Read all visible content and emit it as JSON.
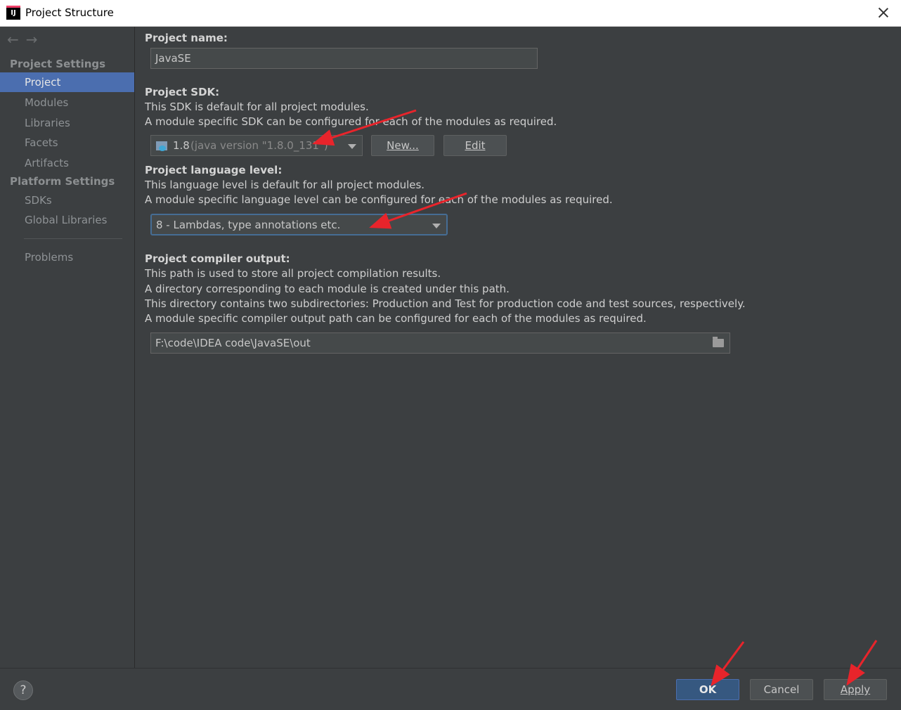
{
  "window": {
    "title": "Project Structure",
    "app_icon_text": "IJ"
  },
  "sidebar": {
    "section_project_settings": "Project Settings",
    "section_platform_settings": "Platform Settings",
    "items": [
      "Project",
      "Modules",
      "Libraries",
      "Facets",
      "Artifacts"
    ],
    "platform_items": [
      "SDKs",
      "Global Libraries"
    ],
    "problems": "Problems",
    "selected": "Project"
  },
  "main": {
    "project_name_label": "Project name:",
    "project_name_value": "JavaSE",
    "sdk_label": "Project SDK:",
    "sdk_desc1": "This SDK is default for all project modules.",
    "sdk_desc2": "A module specific SDK can be configured for each of the modules as required.",
    "sdk_value": "1.8",
    "sdk_version": "(java version \"1.8.0_131\")",
    "sdk_new_button": "New...",
    "sdk_edit_button": "Edit",
    "lang_label": "Project language level:",
    "lang_desc1": "This language level is default for all project modules.",
    "lang_desc2": "A module specific language level can be configured for each of the modules as required.",
    "lang_value": "8 - Lambdas, type annotations etc.",
    "output_label": "Project compiler output:",
    "output_desc1": "This path is used to store all project compilation results.",
    "output_desc2": "A directory corresponding to each module is created under this path.",
    "output_desc3": "This directory contains two subdirectories: Production and Test for production code and test sources, respectively.",
    "output_desc4": "A module specific compiler output path can be configured for each of the modules as required.",
    "output_value": "F:\\code\\IDEA code\\JavaSE\\out"
  },
  "footer": {
    "help": "?",
    "ok": "OK",
    "cancel": "Cancel",
    "apply": "Apply"
  },
  "colors": {
    "background": "#3c3f41",
    "selection": "#4b6eaf",
    "annotation_arrow": "#e8242b",
    "ok_button": "#365880"
  }
}
